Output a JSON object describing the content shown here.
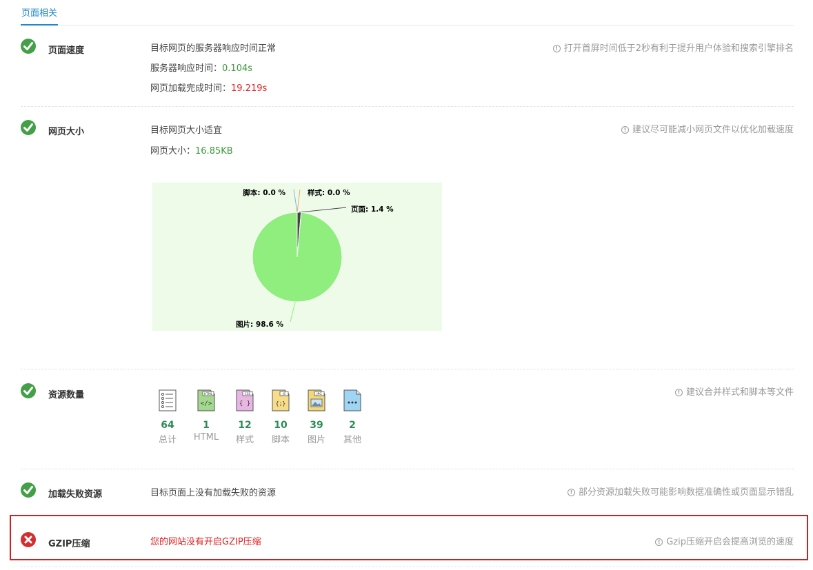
{
  "tab": {
    "label": "页面相关"
  },
  "sections": {
    "speed": {
      "title": "页面速度",
      "summary": "目标网页的服务器响应时间正常",
      "server_label": "服务器响应时间：",
      "server_value": "0.104s",
      "load_label": "网页加载完成时间：",
      "load_value": "19.219s",
      "tip": "打开首屏时间低于2秒有利于提升用户体验和搜索引擎排名"
    },
    "size": {
      "title": "网页大小",
      "summary": "目标网页大小适宜",
      "size_label": "网页大小：",
      "size_value": "16.85KB",
      "tip": "建议尽可能减小网页文件以优化加载速度"
    },
    "resources": {
      "title": "资源数量",
      "tip": "建议合并样式和脚本等文件",
      "items": [
        {
          "icon": "list-doc-icon",
          "count": "64",
          "label": "总计"
        },
        {
          "icon": "html-file-icon",
          "count": "1",
          "label": "HTML"
        },
        {
          "icon": "css-file-icon",
          "count": "12",
          "label": "样式"
        },
        {
          "icon": "js-file-icon",
          "count": "10",
          "label": "脚本"
        },
        {
          "icon": "jpg-file-icon",
          "count": "39",
          "label": "图片"
        },
        {
          "icon": "other-file-icon",
          "count": "2",
          "label": "其他"
        }
      ]
    },
    "failed": {
      "title": "加载失败资源",
      "summary": "目标页面上没有加载失败的资源",
      "tip": "部分资源加载失败可能影响数据准确性或页面显示错乱"
    },
    "gzip": {
      "title": "GZIP压缩",
      "summary": "您的网站没有开启GZIP压缩",
      "tip": "Gzip压缩开启会提高浏览的速度"
    }
  },
  "colors": {
    "accent": "#1e88c8",
    "ok": "#43a047",
    "error": "#d32f2f",
    "pie_main": "#90ee7e",
    "pie_page": "#434348",
    "chart_bg": "#eefbe9"
  },
  "chart_data": {
    "type": "pie",
    "series": [
      {
        "name": "脚本",
        "value": 0.0,
        "label": "脚本: 0.0 %",
        "color": "#7cb5ec"
      },
      {
        "name": "样式",
        "value": 0.0,
        "label": "样式: 0.0 %",
        "color": "#f7a35c"
      },
      {
        "name": "页面",
        "value": 1.4,
        "label": "页面: 1.4 %",
        "color": "#434348"
      },
      {
        "name": "图片",
        "value": 98.6,
        "label": "图片: 98.6 %",
        "color": "#90ee7e"
      }
    ]
  }
}
